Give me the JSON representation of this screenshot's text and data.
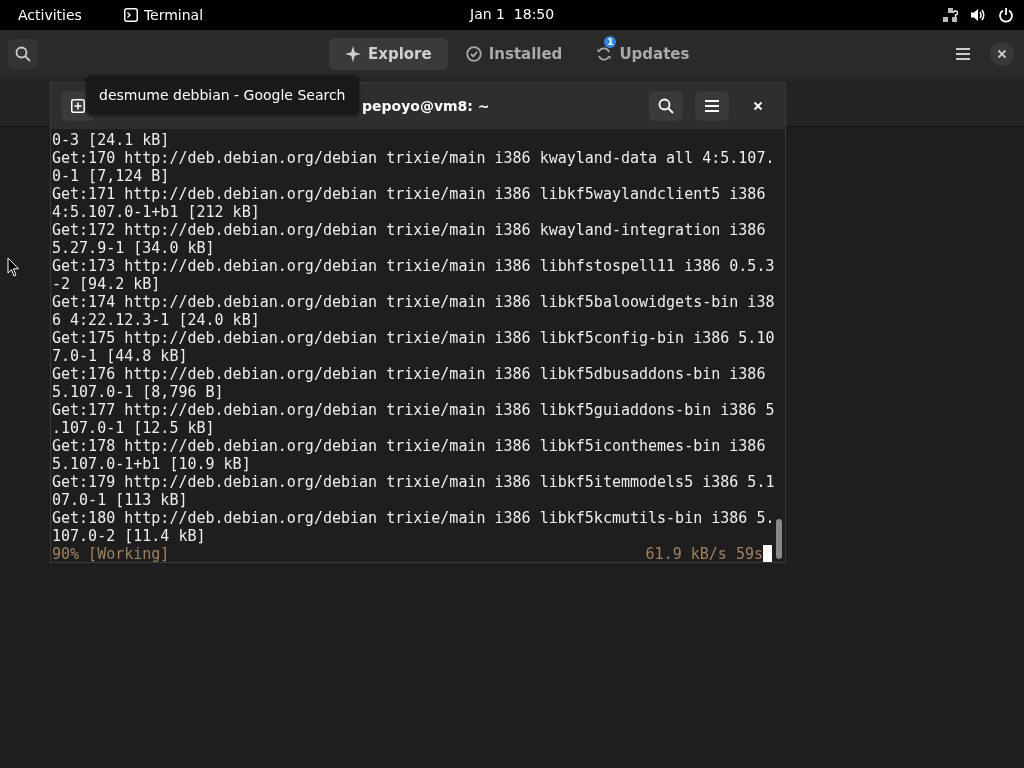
{
  "top_bar": {
    "activities": "Activities",
    "app_name": "Terminal",
    "clock": "Jan 1  18:50"
  },
  "software": {
    "tabs": [
      {
        "label": "Explore",
        "selected": true,
        "kind": "explore"
      },
      {
        "label": "Installed",
        "selected": false,
        "kind": "installed"
      },
      {
        "label": "Updates",
        "selected": false,
        "kind": "updates",
        "badge": "1"
      }
    ]
  },
  "terminal": {
    "title": "pepoyo@vm8: ~",
    "tooltip": "desmume debbian - Google Search",
    "lines": [
      "0-3 [24.1 kB]",
      "Get:170 http://deb.debian.org/debian trixie/main i386 kwayland-data all 4:5.107.",
      "0-1 [7,124 B]",
      "Get:171 http://deb.debian.org/debian trixie/main i386 libkf5waylandclient5 i386",
      "4:5.107.0-1+b1 [212 kB]",
      "Get:172 http://deb.debian.org/debian trixie/main i386 kwayland-integration i386",
      "5.27.9-1 [34.0 kB]",
      "Get:173 http://deb.debian.org/debian trixie/main i386 libhfstospell11 i386 0.5.3",
      "-2 [94.2 kB]",
      "Get:174 http://deb.debian.org/debian trixie/main i386 libkf5baloowidgets-bin i38",
      "6 4:22.12.3-1 [24.0 kB]",
      "Get:175 http://deb.debian.org/debian trixie/main i386 libkf5config-bin i386 5.10",
      "7.0-1 [44.8 kB]",
      "Get:176 http://deb.debian.org/debian trixie/main i386 libkf5dbusaddons-bin i386",
      "5.107.0-1 [8,796 B]",
      "Get:177 http://deb.debian.org/debian trixie/main i386 libkf5guiaddons-bin i386 5",
      ".107.0-1 [12.5 kB]",
      "Get:178 http://deb.debian.org/debian trixie/main i386 libkf5iconthemes-bin i386",
      "5.107.0-1+b1 [10.9 kB]",
      "Get:179 http://deb.debian.org/debian trixie/main i386 libkf5itemmodels5 i386 5.1",
      "07.0-1 [113 kB]",
      "Get:180 http://deb.debian.org/debian trixie/main i386 libkf5kcmutils-bin i386 5.",
      "107.0-2 [11.4 kB]"
    ],
    "status": {
      "progress": "90% [Working]",
      "rate": "61.9 kB/s 59s"
    }
  }
}
